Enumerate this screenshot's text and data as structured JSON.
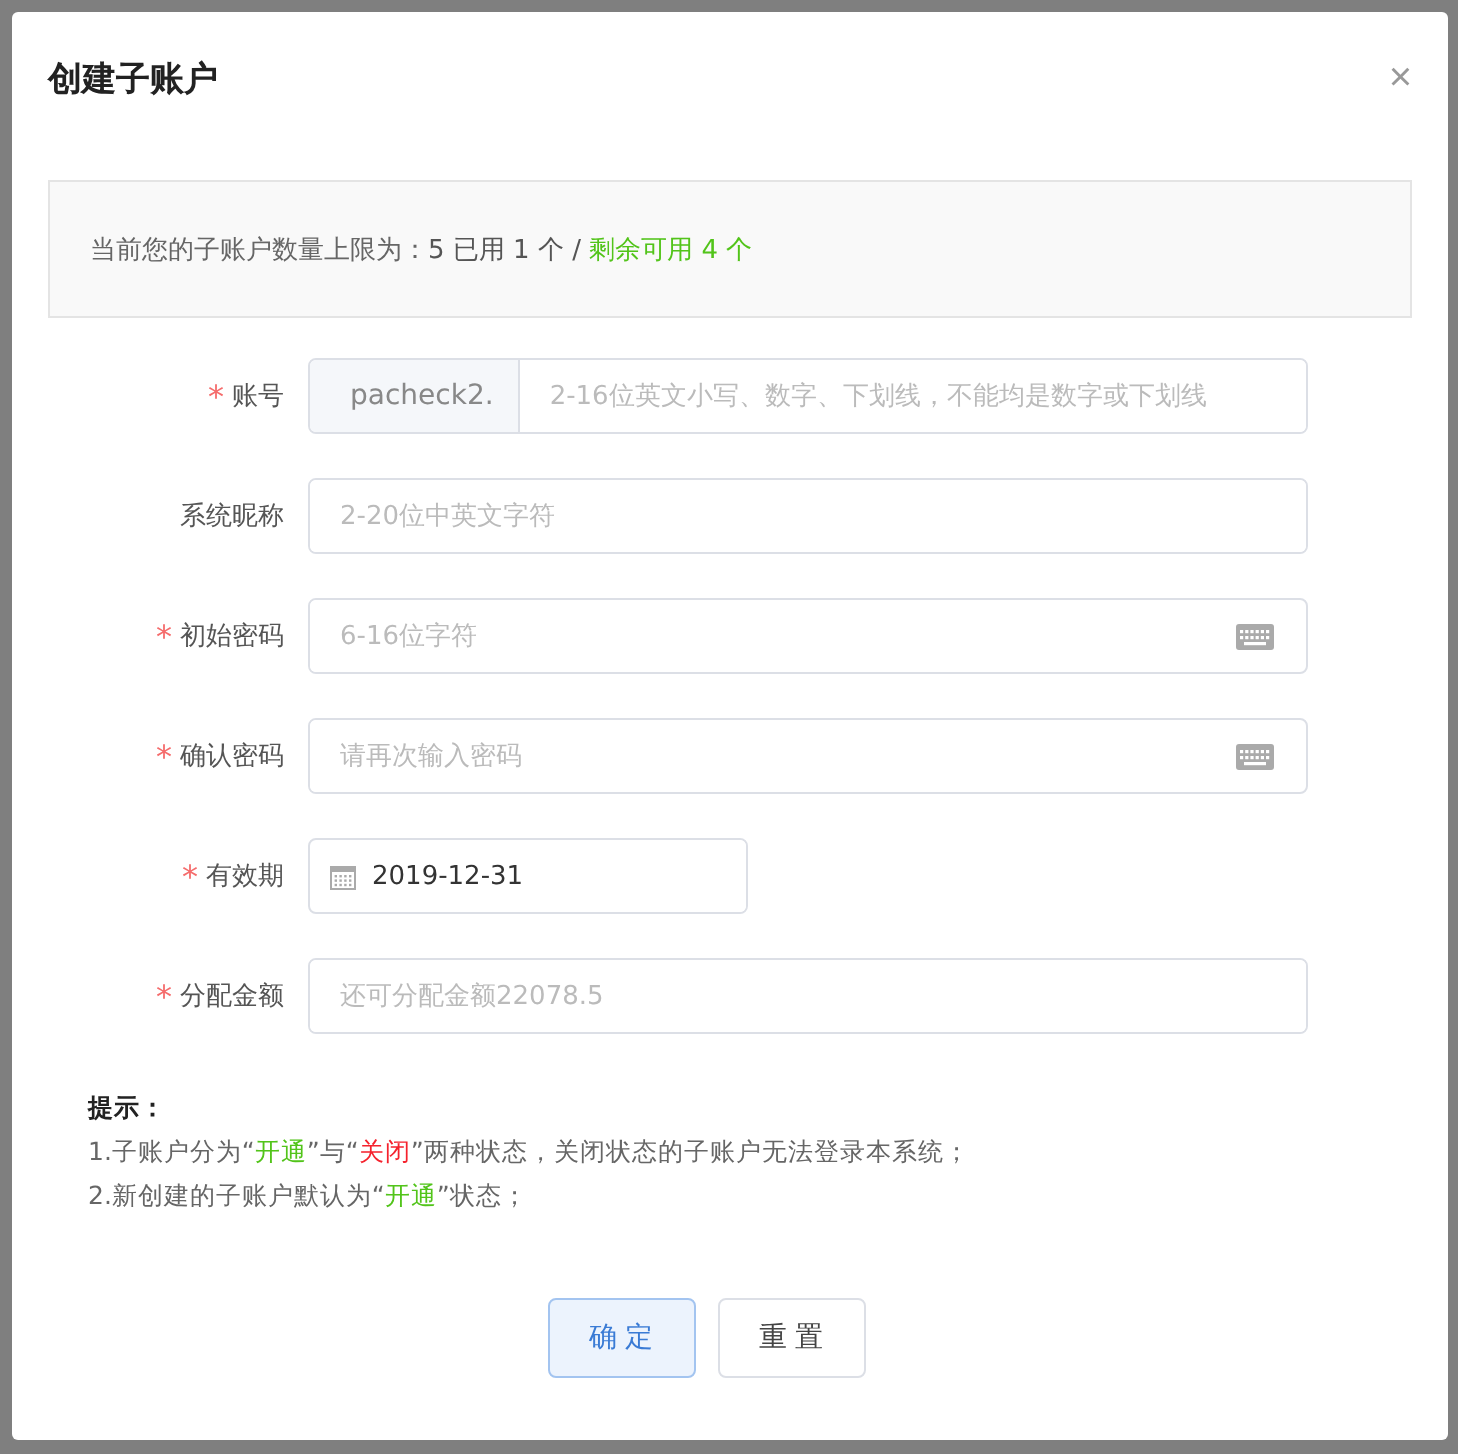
{
  "dialog": {
    "title": "创建子账户",
    "close": "×"
  },
  "notice": [
    {
      "text": "当前您的子账户数量上限为：",
      "color": "#666666"
    },
    {
      "text": "5 已用 1 个 / ",
      "color": "#555555"
    },
    {
      "text": "剩余可用 4 个",
      "color": "#52c41a"
    }
  ],
  "required_mark": "*",
  "fields": [
    {
      "kind": "prefixed",
      "label": "账号",
      "required": true,
      "prefix": "pacheck2.",
      "placeholder": "2-16位英文小写、数字、下划线，不能均是数字或下划线"
    },
    {
      "kind": "text",
      "label": "系统昵称",
      "required": false,
      "placeholder": "2-20位中英文字符"
    },
    {
      "kind": "password",
      "label": "初始密码",
      "required": true,
      "placeholder": "6-16位字符"
    },
    {
      "kind": "password",
      "label": "确认密码",
      "required": true,
      "placeholder": "请再次输入密码"
    },
    {
      "kind": "date",
      "label": "有效期",
      "required": true,
      "value": "2019-12-31"
    },
    {
      "kind": "text",
      "label": "分配金额",
      "required": true,
      "placeholder": "还可分配金额22078.5"
    }
  ],
  "tips": {
    "title": "提示：",
    "lines": [
      [
        {
          "text": "1.子账户分为“",
          "color": "#666666"
        },
        {
          "text": "开通",
          "color": "#52c41a"
        },
        {
          "text": "”与“",
          "color": "#666666"
        },
        {
          "text": "关闭",
          "color": "#f5222d"
        },
        {
          "text": "”两种状态，关闭状态的子账户无法登录本系统；",
          "color": "#666666"
        }
      ],
      [
        {
          "text": "2.新创建的子账户默认为“",
          "color": "#666666"
        },
        {
          "text": "开通",
          "color": "#52c41a"
        },
        {
          "text": "”状态；",
          "color": "#666666"
        }
      ]
    ]
  },
  "buttons": [
    {
      "label": "确 定",
      "kind": "primary"
    },
    {
      "label": "重 置",
      "kind": "default"
    }
  ]
}
